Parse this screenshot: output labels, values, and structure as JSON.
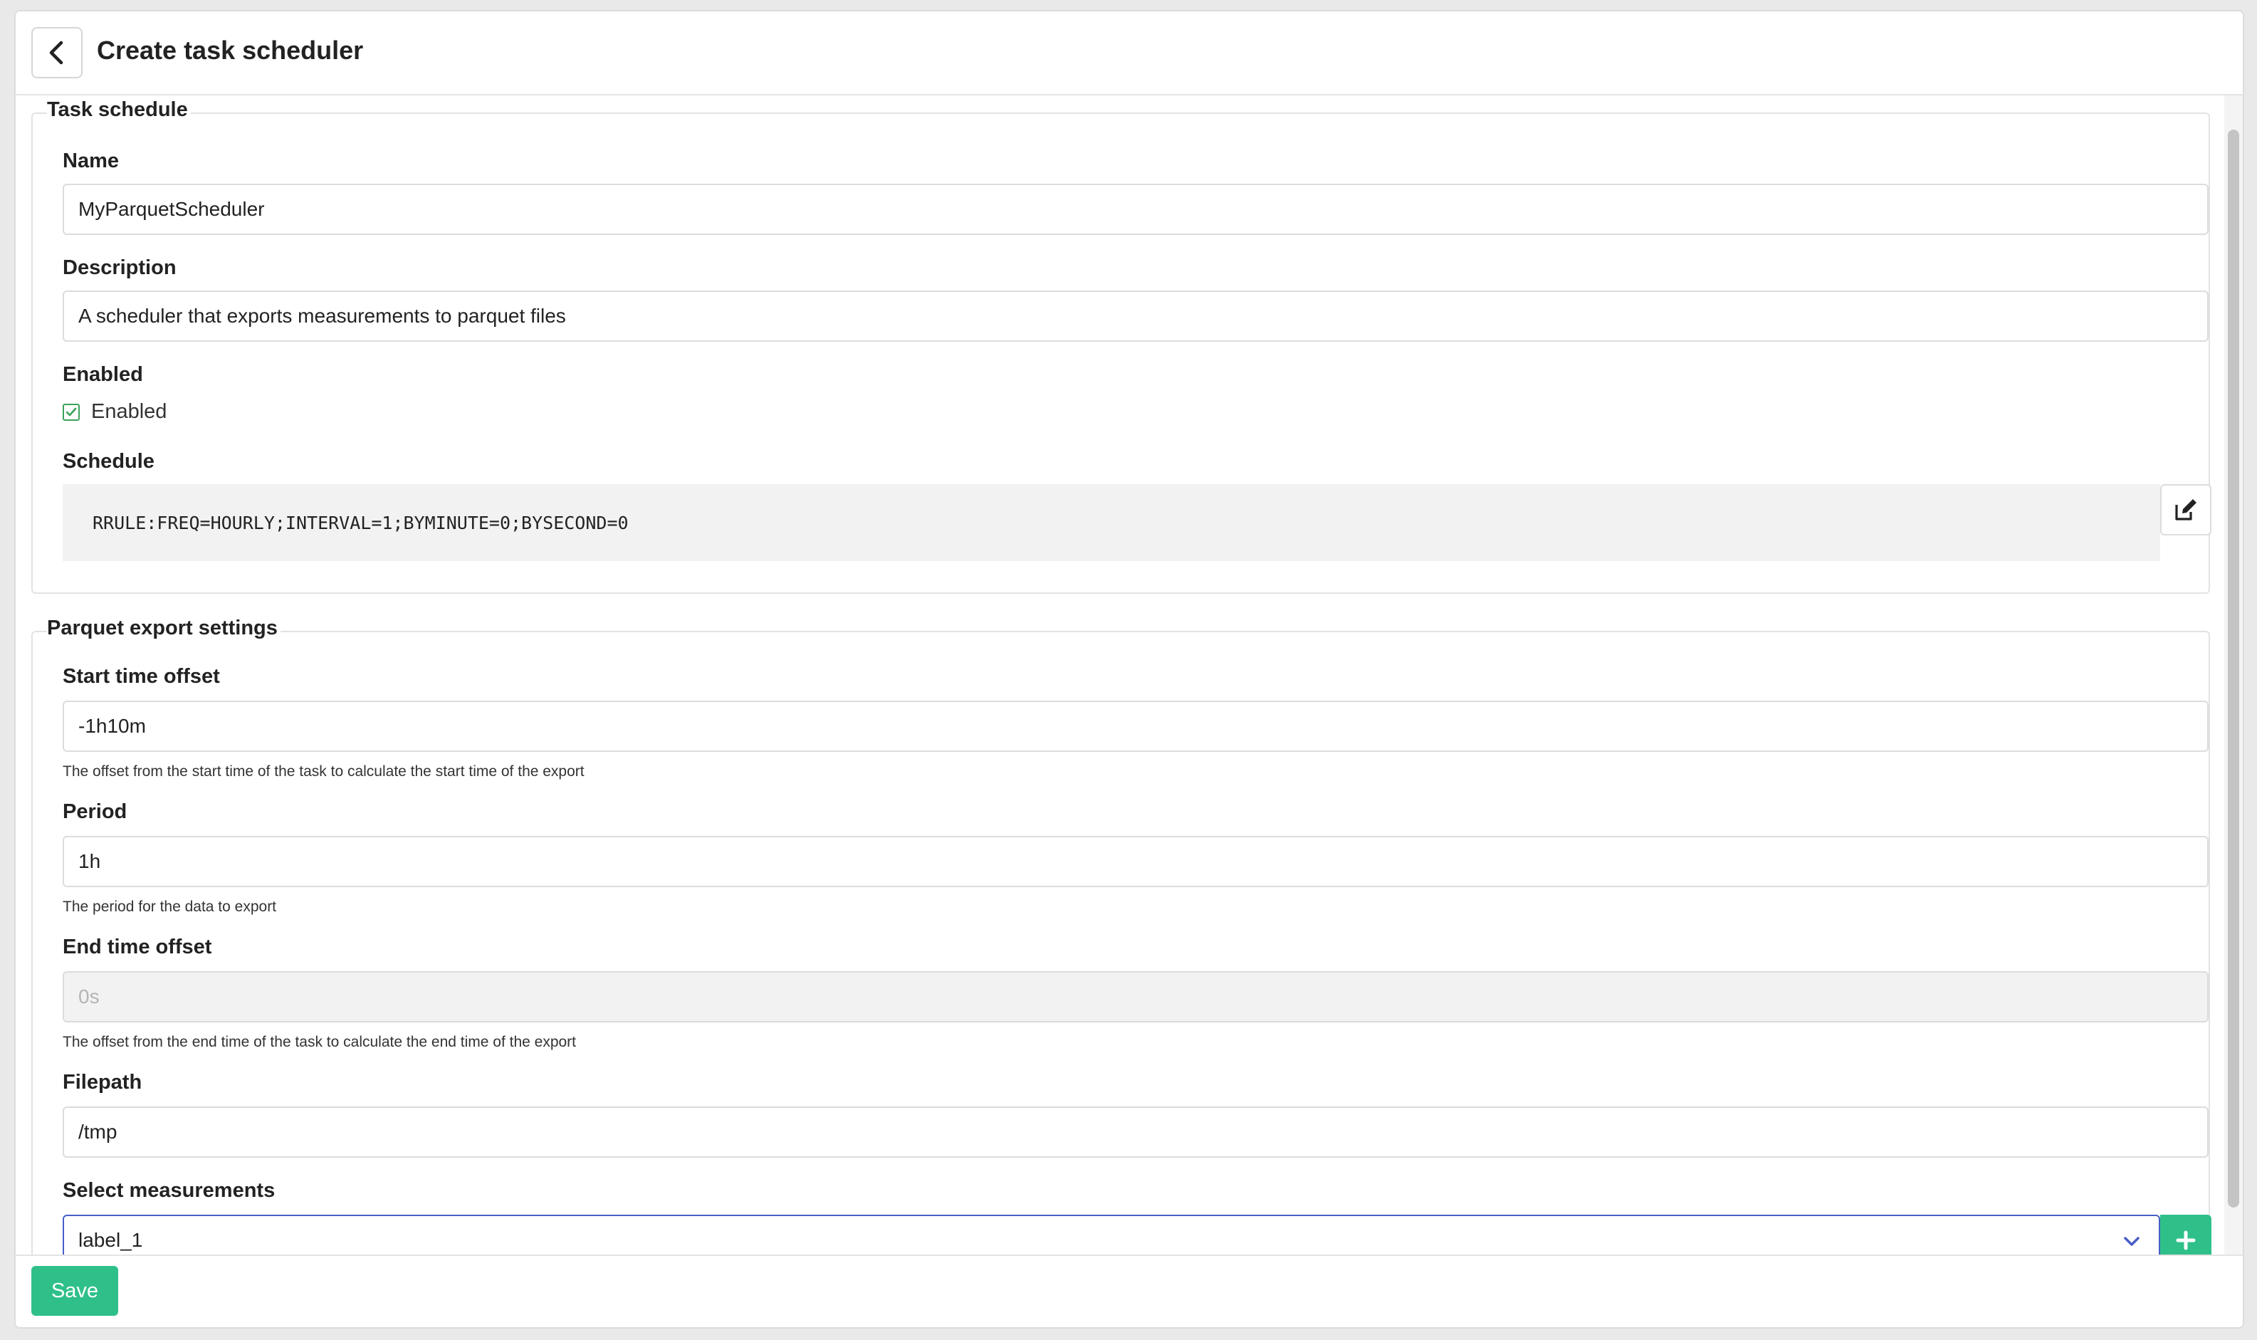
{
  "header": {
    "title": "Create task scheduler",
    "back_icon": "chevron-left-icon"
  },
  "task_schedule": {
    "legend": "Task schedule",
    "name": {
      "label": "Name",
      "value": "MyParquetScheduler"
    },
    "description": {
      "label": "Description",
      "value": "A scheduler that exports measurements to parquet files"
    },
    "enabled": {
      "label": "Enabled",
      "checkbox_label": "Enabled",
      "checked": true
    },
    "schedule": {
      "label": "Schedule",
      "value": "RRULE:FREQ=HOURLY;INTERVAL=1;BYMINUTE=0;BYSECOND=0",
      "edit_icon": "edit-icon"
    }
  },
  "parquet_export": {
    "legend": "Parquet export settings",
    "start_time_offset": {
      "label": "Start time offset",
      "value": "-1h10m",
      "help": "The offset from the start time of the task to calculate the start time of the export"
    },
    "period": {
      "label": "Period",
      "value": "1h",
      "help": "The period for the data to export"
    },
    "end_time_offset": {
      "label": "End time offset",
      "value": "0s",
      "help": "The offset from the end time of the task to calculate the end time of the export",
      "disabled": true
    },
    "filepath": {
      "label": "Filepath",
      "value": "/tmp"
    },
    "measurements": {
      "label": "Select measurements",
      "selected": "label_1",
      "add_icon": "plus-icon"
    }
  },
  "footer": {
    "save_label": "Save"
  },
  "colors": {
    "accent_green": "#2fc08a",
    "focus_blue": "#485fc7",
    "check_green": "#3aa35a"
  }
}
